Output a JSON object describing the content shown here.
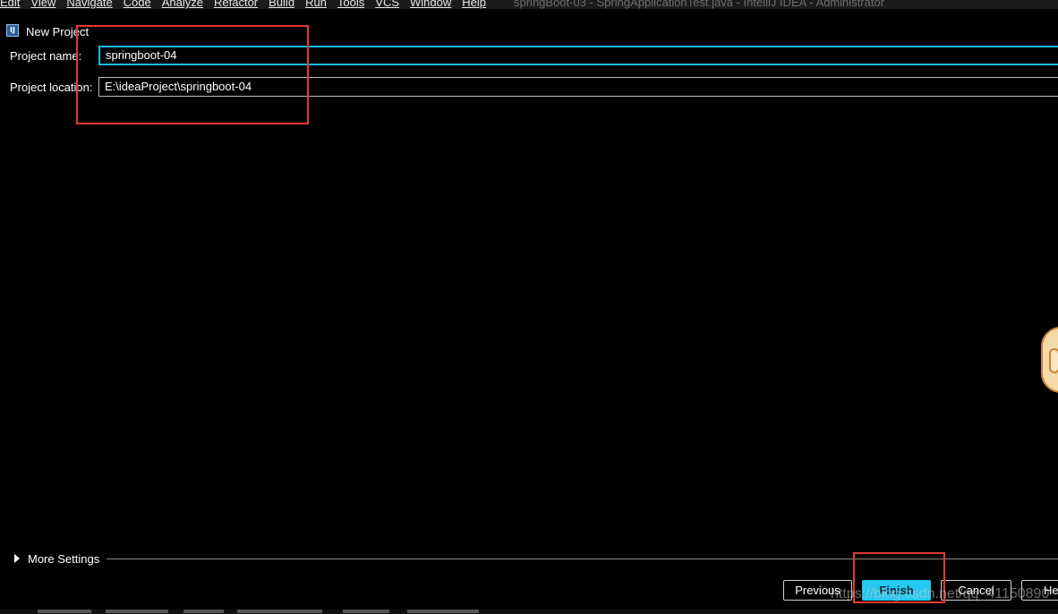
{
  "menu": {
    "items": [
      "Edit",
      "View",
      "Navigate",
      "Code",
      "Analyze",
      "Refactor",
      "Build",
      "Run",
      "Tools",
      "VCS",
      "Window",
      "Help"
    ],
    "window_title": "springBoot-03 - SpringApplicationTest.java - IntelliJ IDEA - Administrator"
  },
  "dialog": {
    "icon_text": "IJ",
    "title": "New Project"
  },
  "form": {
    "project_name_label": "Project name:",
    "project_name_value": "springboot-04",
    "project_location_label": "Project location:",
    "project_location_value": "E:\\ideaProject\\springboot-04"
  },
  "more_settings": {
    "label": "More Settings"
  },
  "buttons": {
    "previous": "Previous",
    "finish": "Finish",
    "cancel": "Cancel",
    "help": "He"
  },
  "watermark": "https://blog.csdn.net/qq_41150890",
  "colors": {
    "accent": "#25c8f0",
    "highlight_box": "#e53935",
    "background": "#000000"
  }
}
